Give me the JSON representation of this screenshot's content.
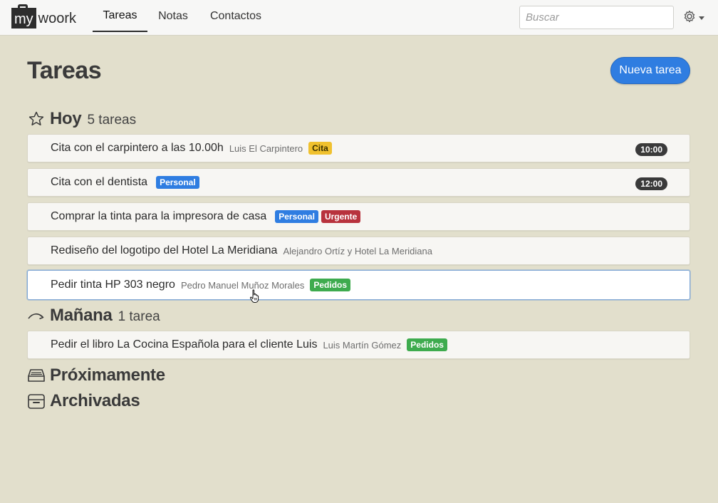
{
  "navbar": {
    "logo_box": "my",
    "logo_text": "woork",
    "tabs": [
      {
        "label": "Tareas",
        "active": true
      },
      {
        "label": "Notas",
        "active": false
      },
      {
        "label": "Contactos",
        "active": false
      }
    ],
    "search_placeholder": "Buscar",
    "settings_icon": "gear-icon"
  },
  "page": {
    "title": "Tareas",
    "new_task_label": "Nueva tarea"
  },
  "sections": {
    "hoy": {
      "title": "Hoy",
      "count": "5 tareas",
      "icon": "star-icon",
      "tasks": [
        {
          "title": "Cita con el carpintero a las 10.00h",
          "contact": "Luis El Carpintero",
          "tags": [
            "Cita"
          ],
          "time": "10:00"
        },
        {
          "title": "Cita con el dentista",
          "contact": "",
          "tags": [
            "Personal"
          ],
          "time": "12:00"
        },
        {
          "title": "Comprar la tinta para la impresora de casa",
          "contact": "",
          "tags": [
            "Personal",
            "Urgente"
          ],
          "time": ""
        },
        {
          "title": "Rediseño del logotipo del Hotel La Meridiana",
          "contact": "Alejandro Ortíz y Hotel La Meridiana",
          "tags": [],
          "time": ""
        },
        {
          "title": "Pedir tinta HP 303 negro",
          "contact": "Pedro Manuel Muñoz Morales",
          "tags": [
            "Pedidos"
          ],
          "time": "",
          "selected": true
        }
      ]
    },
    "manana": {
      "title": "Mañana",
      "count": "1 tarea",
      "icon": "forward-arrow-icon",
      "tasks": [
        {
          "title": "Pedir el libro La Cocina Española para el cliente Luis",
          "contact": "Luis Martín Gómez",
          "tags": [
            "Pedidos"
          ],
          "time": ""
        }
      ]
    },
    "proximamente": {
      "title": "Próximamente",
      "icon": "inbox-tray-icon"
    },
    "archivadas": {
      "title": "Archivadas",
      "icon": "archive-box-icon"
    }
  },
  "colors": {
    "background": "#e2dfcc",
    "accent": "#2f7de1",
    "tag_cita": "#f0c12e",
    "tag_personal": "#2f7de1",
    "tag_urgente": "#b8323d",
    "tag_pedidos": "#3eab4e"
  }
}
